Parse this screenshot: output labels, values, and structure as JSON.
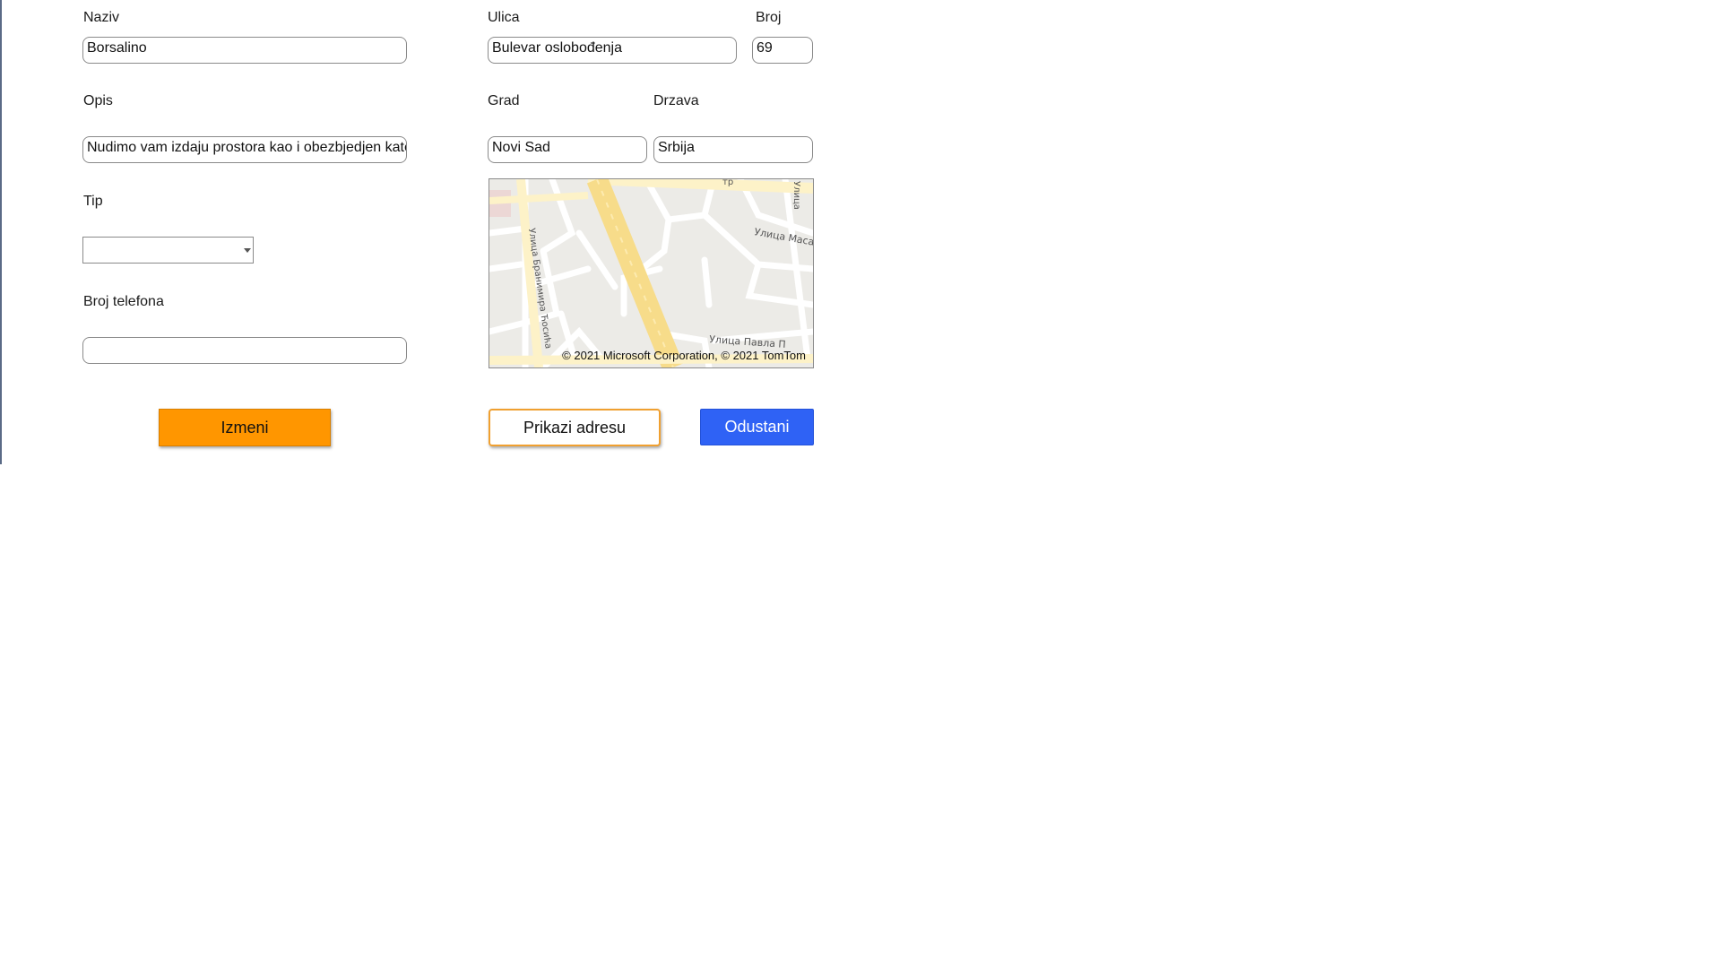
{
  "form": {
    "naziv": {
      "label": "Naziv",
      "value": "Borsalino"
    },
    "opis": {
      "label": "Opis",
      "value": "Nudimo vam izdaju prostora kao i obezbjedjen kateri"
    },
    "tip": {
      "label": "Tip",
      "value": ""
    },
    "telefon": {
      "label": "Broj telefona",
      "value": ""
    },
    "ulica": {
      "label": "Ulica",
      "value": "Bulevar oslobođenja"
    },
    "broj": {
      "label": "Broj",
      "value": "69"
    },
    "grad": {
      "label": "Grad",
      "value": "Novi Sad"
    },
    "drzava": {
      "label": "Drzava",
      "value": "Srbija"
    }
  },
  "map": {
    "copyright": "© 2021 Microsoft Corporation, © 2021 TomTom",
    "street_labels": [
      "Улица Масар",
      "Улица Бранимира Ћосића",
      "Улица Павла П",
      "Улица",
      "тр"
    ]
  },
  "buttons": {
    "izmeni": "Izmeni",
    "prikazi": "Prikazi adresu",
    "odustani": "Odustani"
  },
  "colors": {
    "orange": "#ff9600",
    "blue": "#2f62f5",
    "map_bg": "#ecebe7",
    "main_road": "#f7dc8a"
  }
}
